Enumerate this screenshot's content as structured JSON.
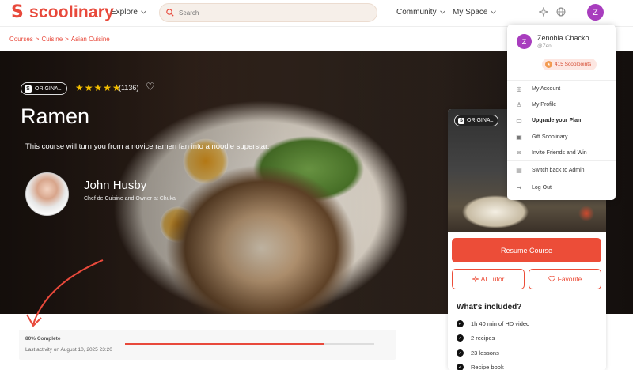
{
  "header": {
    "logo_text": "scoolinary",
    "explore_label": "Explore",
    "search_placeholder": "Search",
    "community_label": "Community",
    "myspace_label": "My Space",
    "avatar_initial": "Z"
  },
  "breadcrumb": {
    "items": [
      "Courses",
      "Cuisine",
      "Asian Cuisine"
    ],
    "separator": ">"
  },
  "course": {
    "badge": "ORIGINAL",
    "stars": "★★★★★",
    "rating_count": "(1136)",
    "title": "Ramen",
    "description": "This course will turn you from a novice ramen fan into a noodle superstar.",
    "chef_name": "John Husby",
    "chef_role": "Chef de Cuisine and Owner at Chuka"
  },
  "progress": {
    "label": "80% Complete",
    "percent": 80,
    "last_activity": "Last activity on August 10, 2025 23:20"
  },
  "side_card": {
    "badge": "ORIGINAL",
    "resume_label": "Resume Course",
    "ai_tutor_label": "AI Tutor",
    "favorite_label": "Favorite",
    "included_title": "What's included?",
    "included_items": [
      "1h 40 min of HD video",
      "2 recipes",
      "23 lessons",
      "Recipe book"
    ]
  },
  "dropdown": {
    "avatar_initial": "Z",
    "name": "Zenobia Chacko",
    "handle": "@Zen",
    "points": "415 Scoolpoints",
    "items": [
      "My Account",
      "My Profile",
      "Upgrade your Plan",
      "Gift Scoolinary",
      "Invite Friends and Win",
      "Switch back to Admin",
      "Log Out"
    ]
  },
  "colors": {
    "brand": "#e8493b",
    "avatar": "#a83dbe",
    "stars": "#f5c000"
  }
}
